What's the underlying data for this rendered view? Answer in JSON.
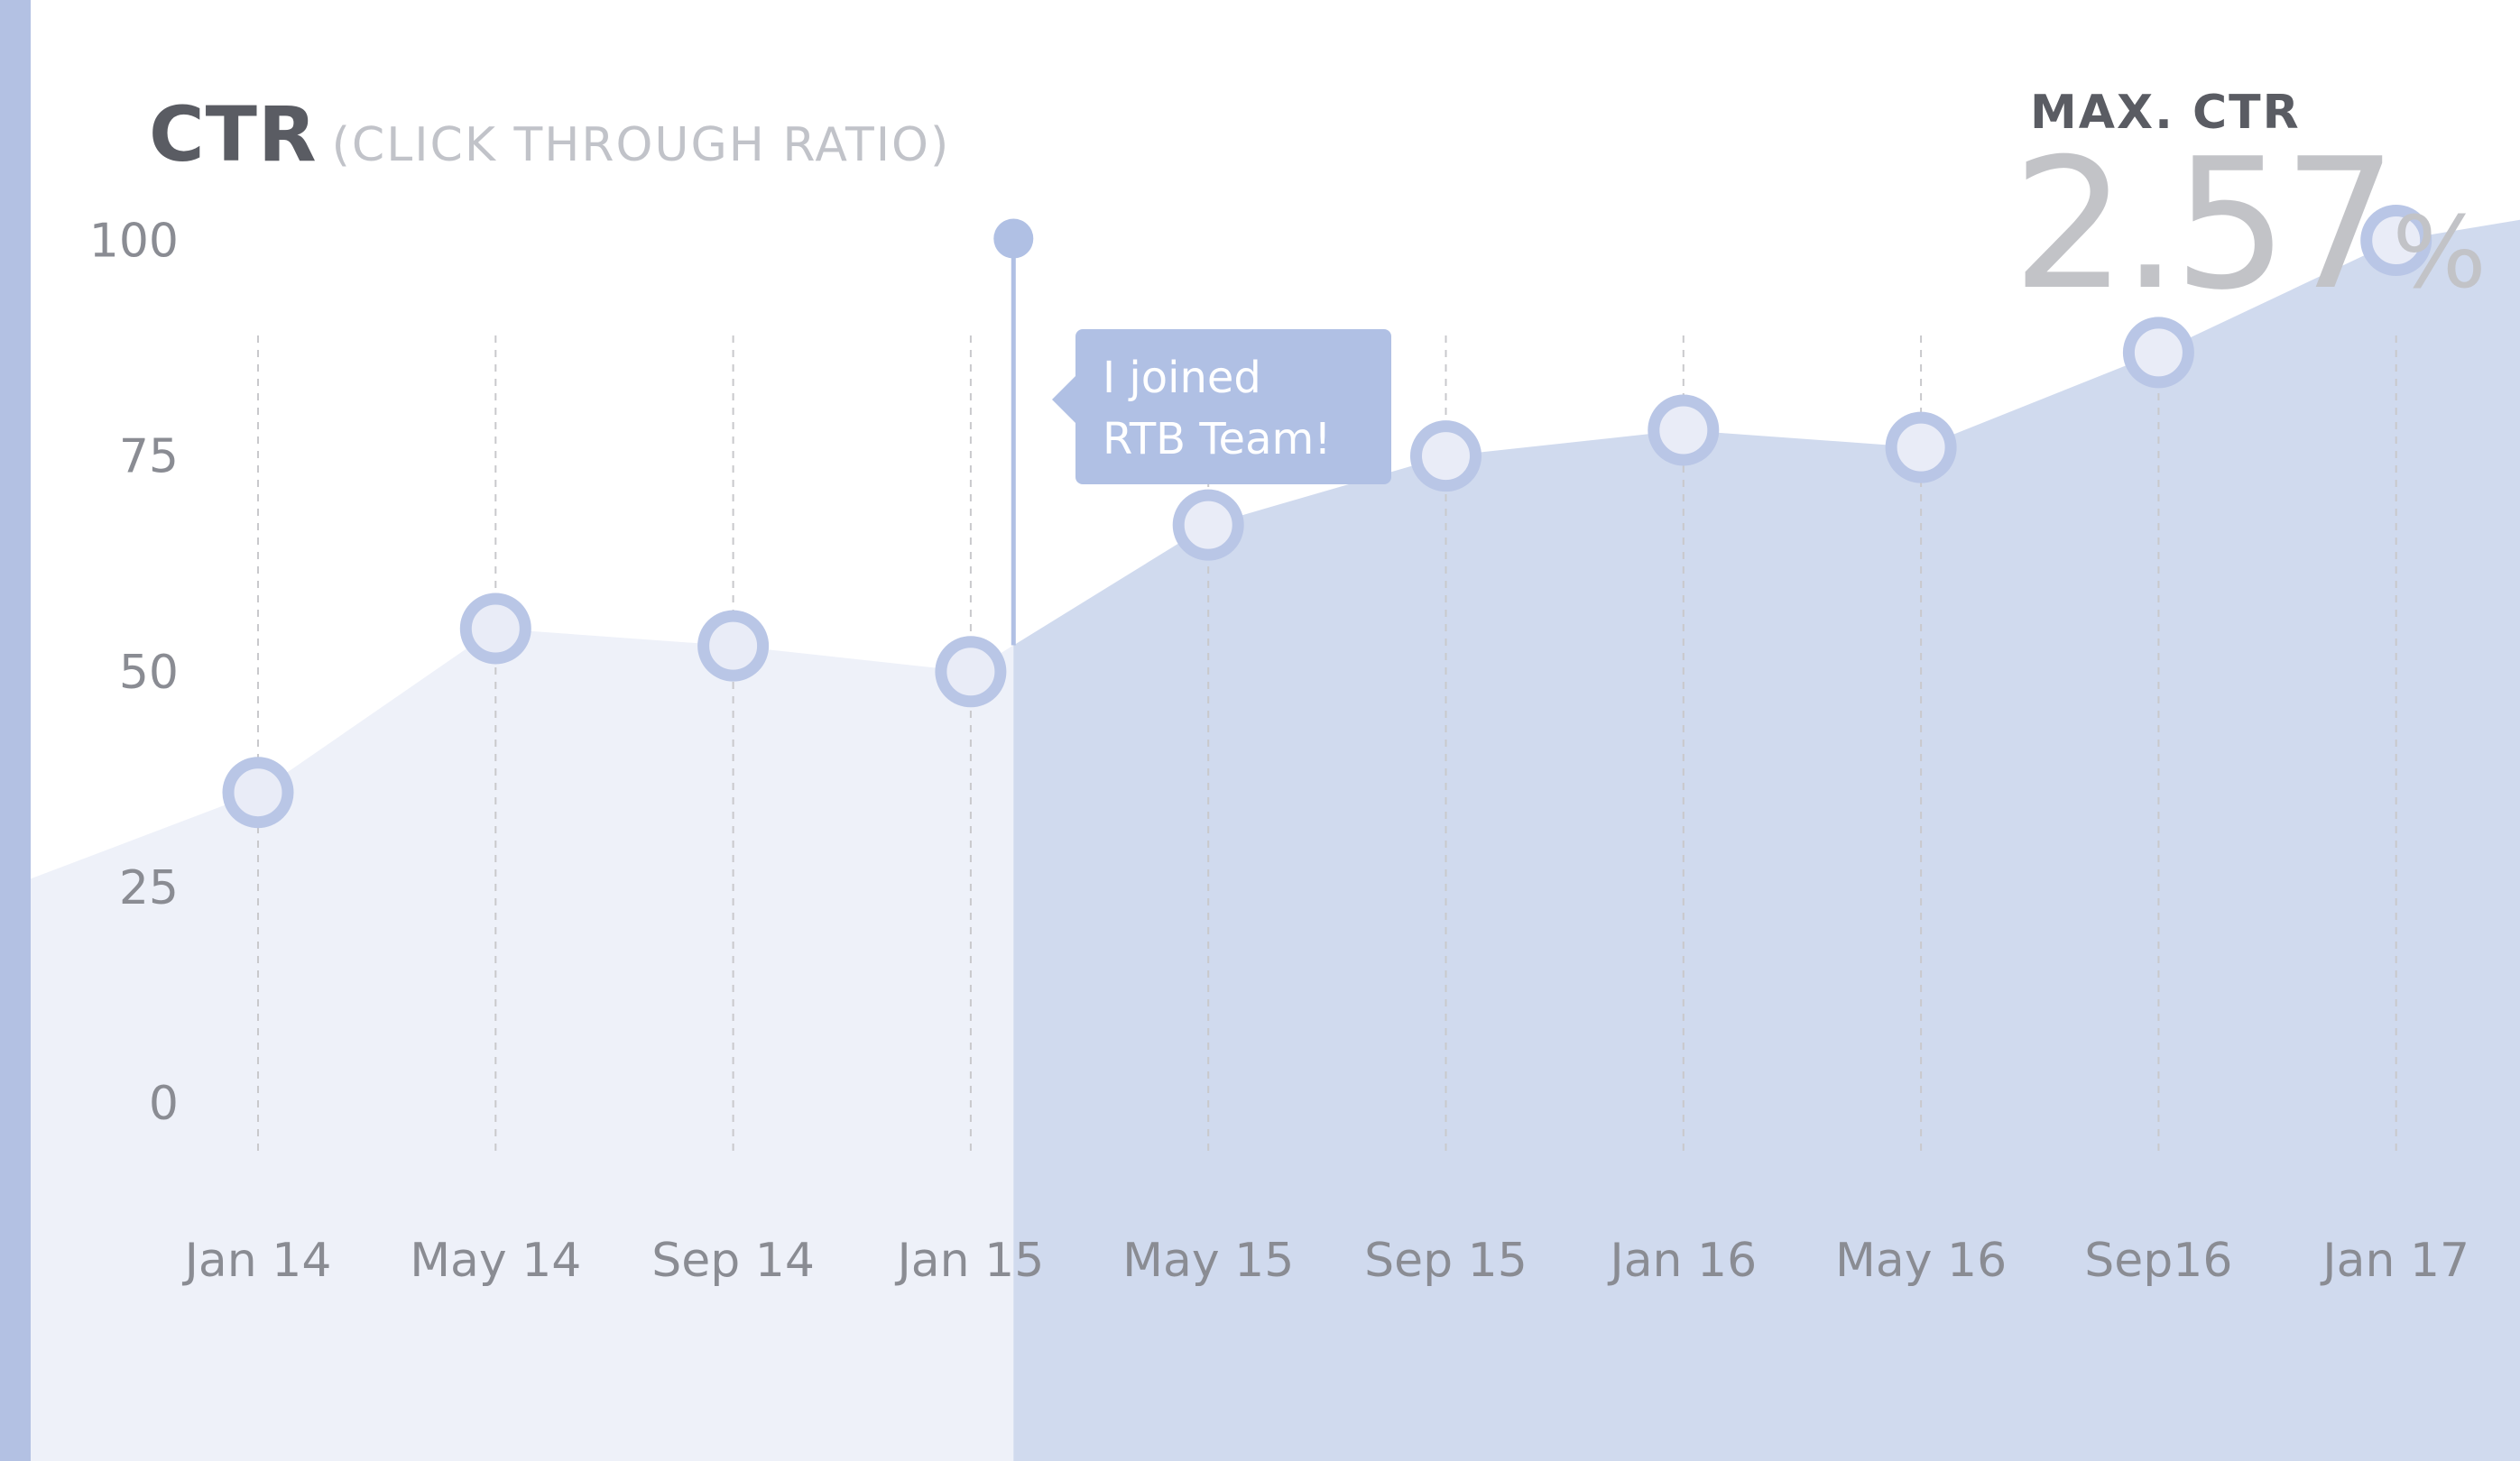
{
  "header": {
    "title": "CTR",
    "subtitle": "(CLICK THROUGH RATIO)"
  },
  "stat": {
    "label": "MAX. CTR",
    "value": "2.57",
    "unit": "%"
  },
  "annotation": {
    "line1": "I joined",
    "line2": "RTB Team!"
  },
  "colors": {
    "accent": "#b3c1e3",
    "marker_ring": "#b9c6e6",
    "marker_fill": "#e9ecf7",
    "area_before": "#eef1f9",
    "area_after": "#d0daee",
    "grid": "#c9c9cc",
    "tick_text": "#8a8c93",
    "annotation_bg": "#b0c0e4"
  },
  "chart_data": {
    "type": "area",
    "categories": [
      "Jan 14",
      "May 14",
      "Sep 14",
      "Jan 15",
      "May 15",
      "Sep 15",
      "Jan 16",
      "May 16",
      "Sep16",
      "Jan 17"
    ],
    "values": [
      36,
      55,
      53,
      50,
      67,
      75,
      78,
      76,
      87,
      100
    ],
    "yticks": [
      0,
      25,
      50,
      75,
      100
    ],
    "ylim": [
      -7,
      108
    ],
    "grid": "vertical dashed",
    "highlight": {
      "from_between": [
        "Jan 15",
        "May 15"
      ],
      "label_ref": "annotation"
    }
  }
}
